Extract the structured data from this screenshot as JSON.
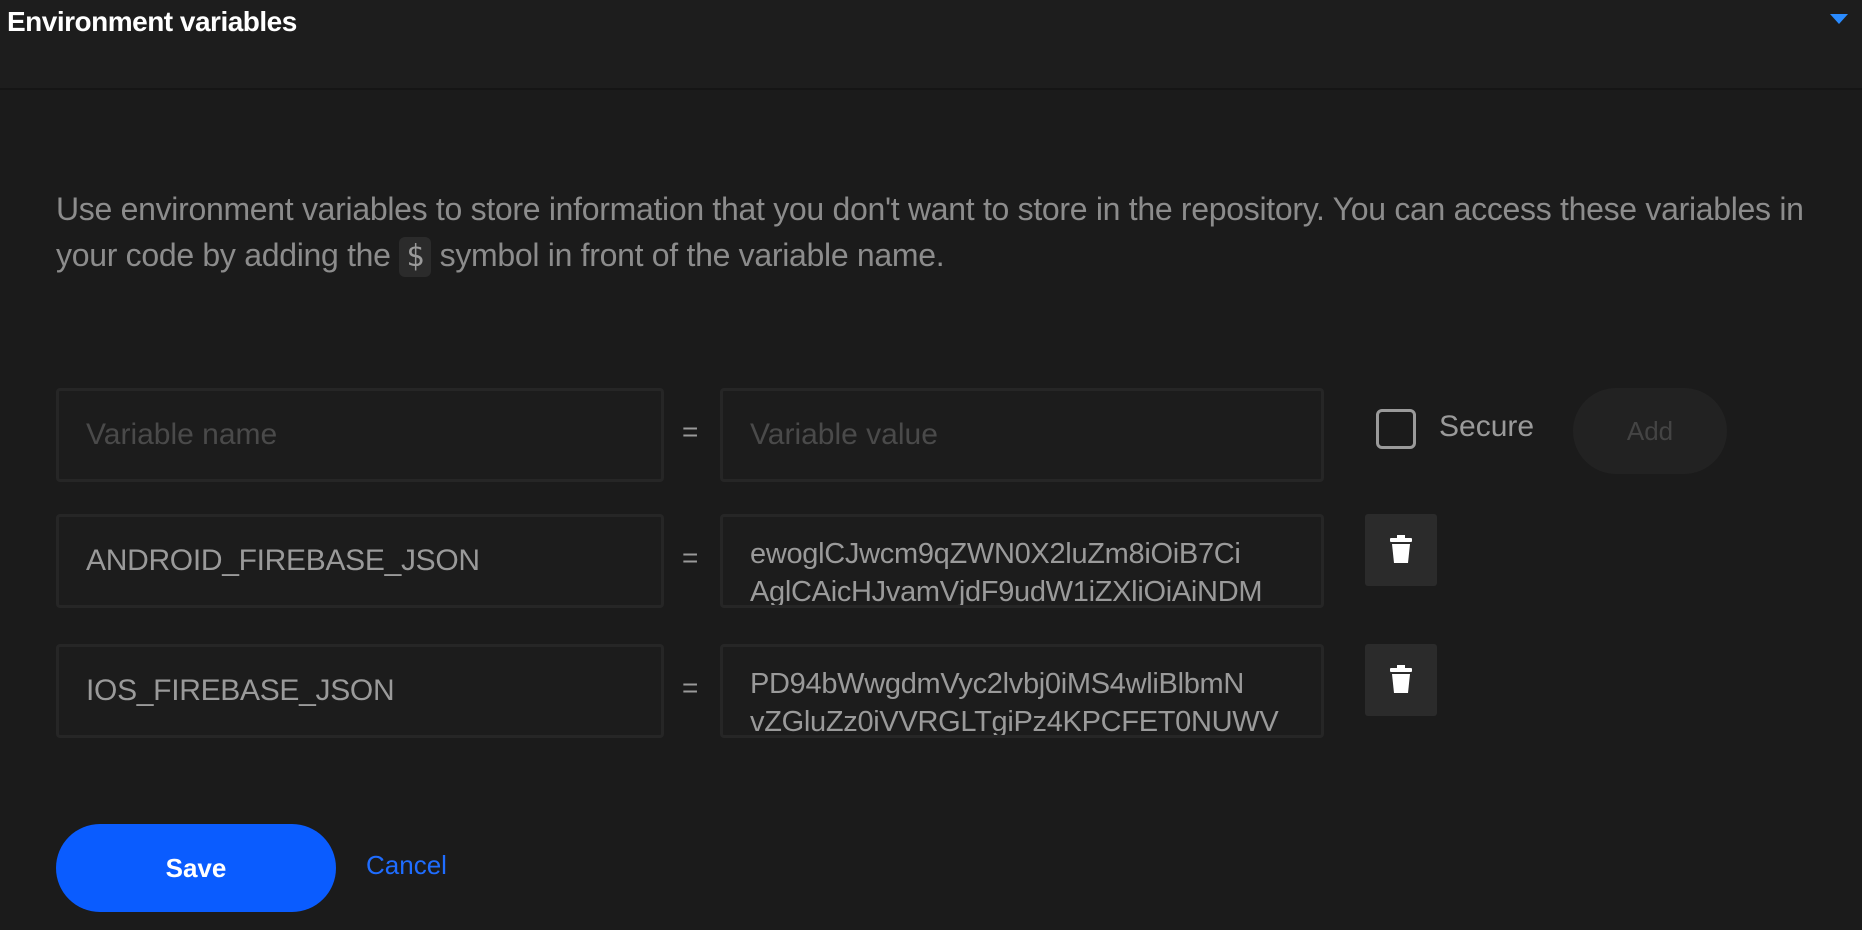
{
  "header": {
    "title": "Environment variables"
  },
  "description": {
    "before": "Use environment variables to store information that you don't want to store in the repository. You can access these variables in your code by adding the ",
    "symbol": "$",
    "after": " symbol in front of the variable name."
  },
  "new_variable": {
    "name_placeholder": "Variable name",
    "value_placeholder": "Variable value",
    "equals": "=",
    "secure_label": "Secure",
    "secure_checked": false,
    "add_label": "Add"
  },
  "variables": [
    {
      "name": "ANDROID_FIREBASE_JSON",
      "equals": "=",
      "value": "ewoglCJwcm9qZWN0X2luZm8iOiB7Ci\nAglCAicHJvamVjdF9udW1iZXliOiAiNDM"
    },
    {
      "name": "IOS_FIREBASE_JSON",
      "equals": "=",
      "value": "PD94bWwgdmVyc2lvbj0iMS4wliBlbmN\nvZGluZz0iVVRGLTgiPz4KPCFET0NUWV"
    }
  ],
  "actions": {
    "save_label": "Save",
    "cancel_label": "Cancel"
  },
  "colors": {
    "background": "#1b1b1b",
    "accent": "#0a5cff",
    "link": "#1f6dff",
    "toggle": "#2a8bff"
  },
  "icons": {
    "collapse": "triangle-down-icon",
    "delete": "trash-icon"
  }
}
